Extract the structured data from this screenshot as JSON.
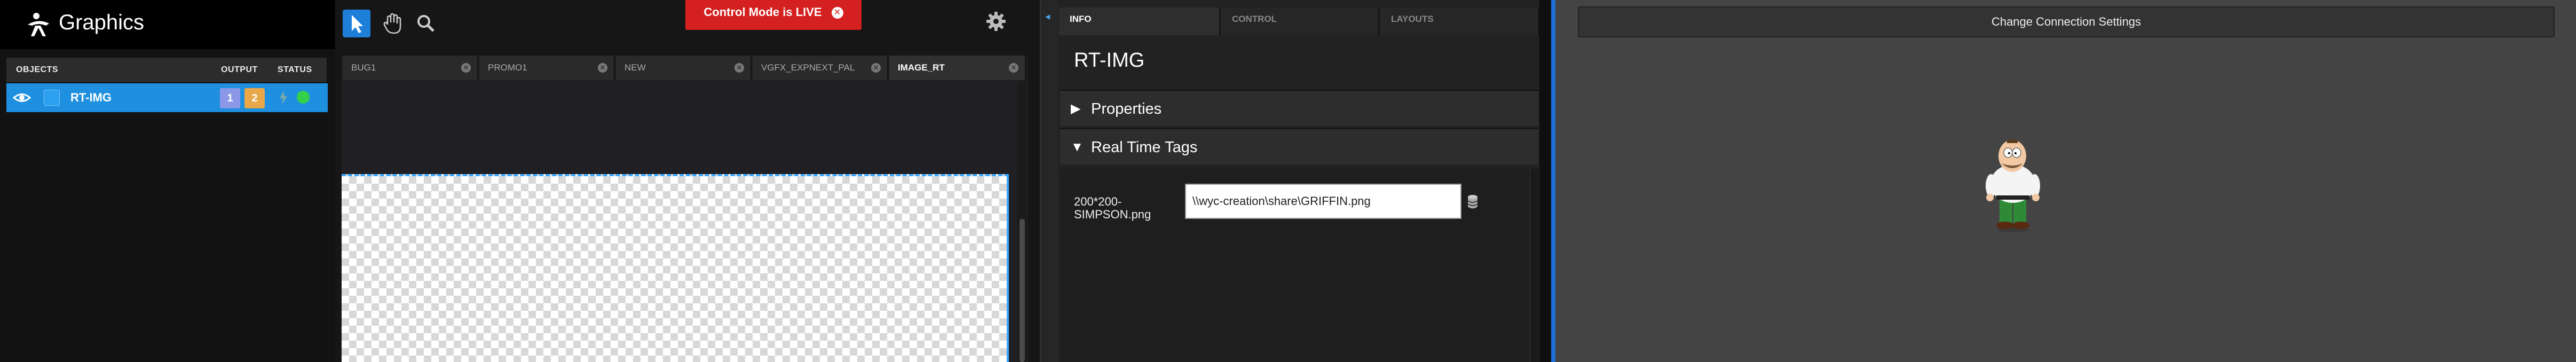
{
  "app": {
    "title": "Graphics"
  },
  "objects_panel": {
    "headers": {
      "objects": "OBJECTS",
      "output": "OUTPUT",
      "status": "STATUS"
    },
    "rows": [
      {
        "name": "RT-IMG",
        "outputs": [
          "1",
          "2"
        ],
        "status_color": "#34d04c"
      }
    ]
  },
  "toolbar": {
    "tools": [
      "pointer-tool",
      "hand-tool",
      "zoom-tool"
    ],
    "live_banner": "Control Mode is LIVE"
  },
  "document_tabs": [
    {
      "label": "BUG1",
      "active": false
    },
    {
      "label": "PROMO1",
      "active": false
    },
    {
      "label": "NEW",
      "active": false
    },
    {
      "label": "VGFX_EXPNEXT_PAL",
      "active": false
    },
    {
      "label": "IMAGE_RT",
      "active": true
    }
  ],
  "info_panel": {
    "tabs": [
      {
        "label": "INFO",
        "active": true
      },
      {
        "label": "CONTROL",
        "active": false
      },
      {
        "label": "LAYOUTS",
        "active": false
      }
    ],
    "object_title": "RT-IMG",
    "sections": {
      "properties": "Properties",
      "real_time_tags": "Real Time Tags"
    },
    "tag": {
      "label": "200*200-SIMPSON.png",
      "value": "\\\\wyc-creation\\share\\GRIFFIN.png"
    }
  },
  "preview": {
    "connection_button": "Change Connection Settings"
  },
  "colors": {
    "accent_blue": "#1f8fe0",
    "live_red": "#d42020",
    "output1": "#8b98e8",
    "output2": "#e8a84a"
  }
}
